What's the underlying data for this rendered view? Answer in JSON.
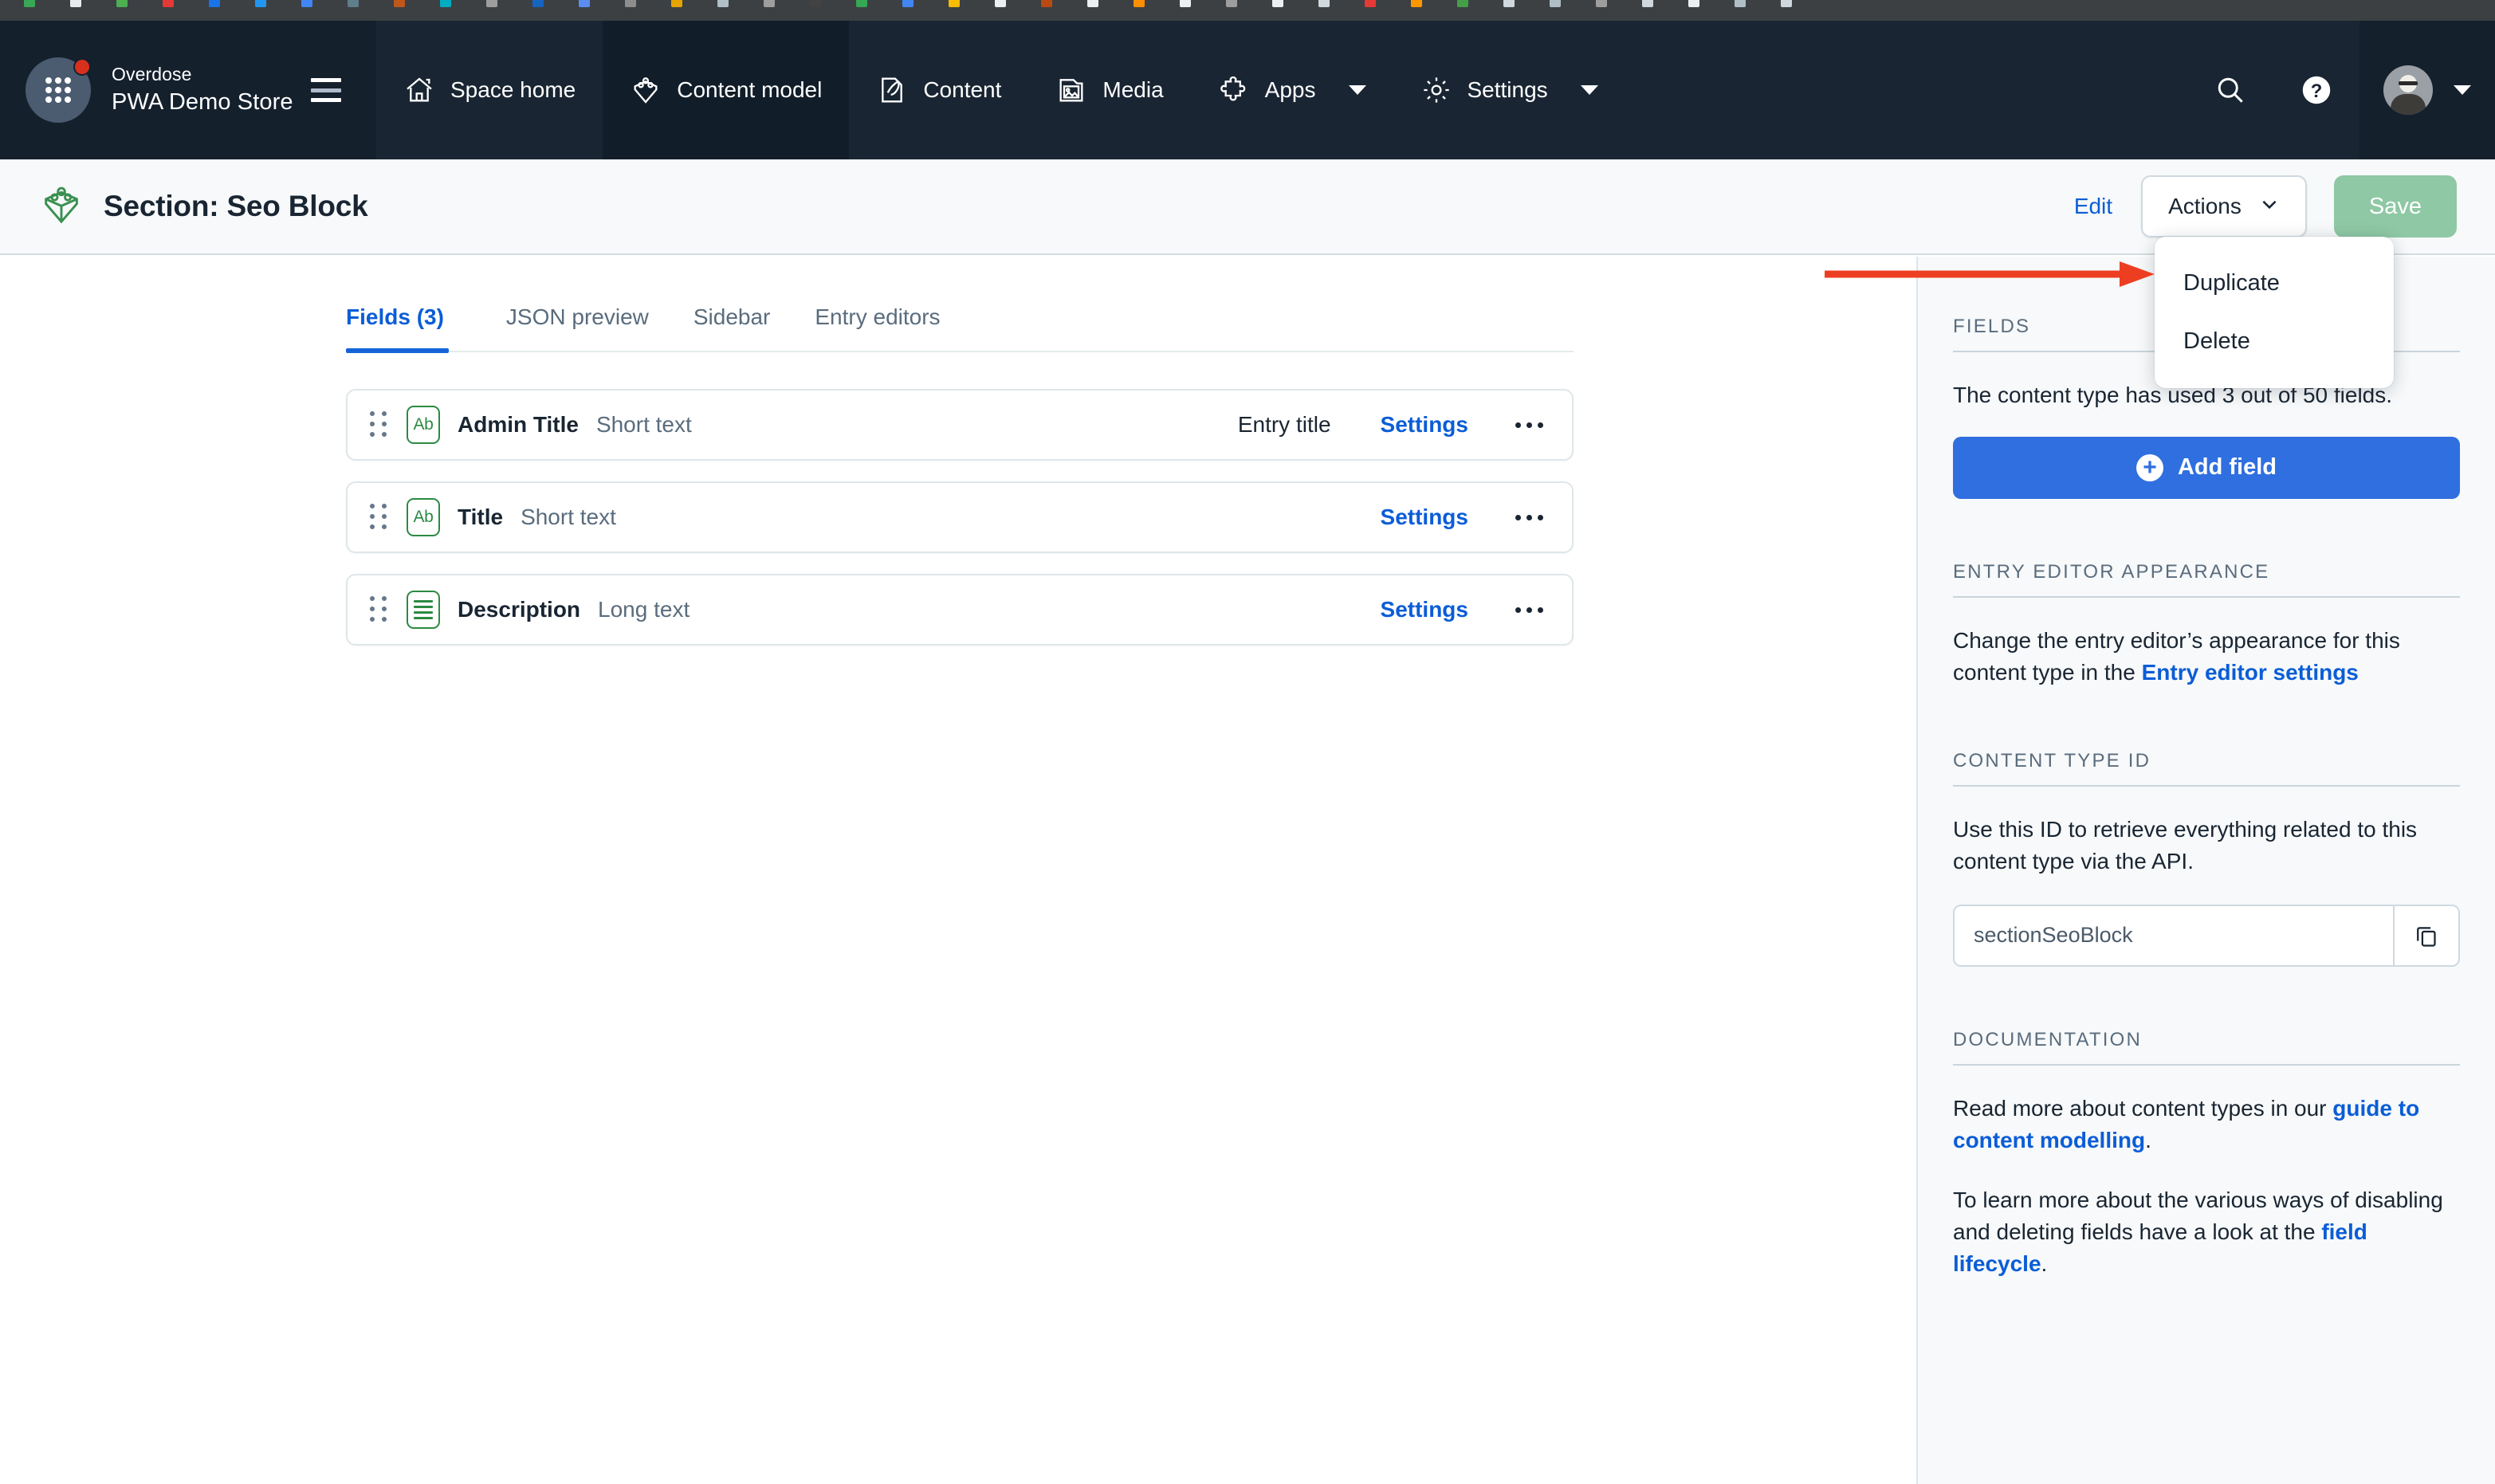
{
  "browser": {
    "favicon_colors": [
      "#3aa757",
      "#e8eaed",
      "#4caf50",
      "#e53935",
      "#1a73e8",
      "#2196f3",
      "#4285f4",
      "#607d8b",
      "#c0571a",
      "#00acc1",
      "#9e9e9e",
      "#1565c0",
      "#5b8def",
      "#8d8d8d",
      "#e6a400",
      "#b0bec5",
      "#9e9e9e",
      "#424242",
      "#34a853",
      "#4285f4",
      "#fbbc05",
      "#eceff1",
      "#b84a12",
      "#eceff1",
      "#ff8f00",
      "#eceff1",
      "#9e9e9e",
      "#eceff1",
      "#cfd8dc",
      "#e53935",
      "#ff9800",
      "#43a047",
      "#cfd8dc",
      "#b0bec5",
      "#9e9e9e",
      "#cfd8dc",
      "#eceff1",
      "#b0bec5",
      "#cfd8dc"
    ]
  },
  "topnav": {
    "org_name": "Overdose",
    "space_name": "PWA Demo Store",
    "menu_icon": "hamburger-icon",
    "items": [
      {
        "label": "Space home",
        "icon": "home-icon",
        "active": false,
        "has_caret": false
      },
      {
        "label": "Content model",
        "icon": "content-model-icon",
        "active": true,
        "has_caret": false
      },
      {
        "label": "Content",
        "icon": "content-pen-icon",
        "active": false,
        "has_caret": false
      },
      {
        "label": "Media",
        "icon": "media-image-icon",
        "active": false,
        "has_caret": false
      },
      {
        "label": "Apps",
        "icon": "puzzle-icon",
        "active": false,
        "has_caret": true
      },
      {
        "label": "Settings",
        "icon": "gear-icon",
        "active": false,
        "has_caret": true
      }
    ],
    "search_icon": "search-icon",
    "help_icon": "help-circle-icon",
    "avatar_icon": "user-avatar",
    "user_caret": "chevron-down-icon"
  },
  "header": {
    "icon": "content-type-block-icon",
    "title": "Section: Seo Block",
    "edit_label": "Edit",
    "actions_label": "Actions",
    "actions_caret": "chevron-down-icon",
    "save_label": "Save"
  },
  "actions_menu": {
    "items": [
      {
        "label": "Duplicate"
      },
      {
        "label": "Delete"
      }
    ]
  },
  "main": {
    "tabs": [
      {
        "label": "Fields (3)",
        "active": true
      },
      {
        "label": "JSON preview",
        "active": false
      },
      {
        "label": "Sidebar",
        "active": false
      },
      {
        "label": "Entry editors",
        "active": false
      }
    ],
    "fields": [
      {
        "name": "Admin Title",
        "type": "Short text",
        "type_icon": "short-text-icon",
        "badge": "Entry title",
        "settings_label": "Settings",
        "more_icon": "ellipsis-icon"
      },
      {
        "name": "Title",
        "type": "Short text",
        "type_icon": "short-text-icon",
        "badge": "",
        "settings_label": "Settings",
        "more_icon": "ellipsis-icon"
      },
      {
        "name": "Description",
        "type": "Long text",
        "type_icon": "long-text-icon",
        "badge": "",
        "settings_label": "Settings",
        "more_icon": "ellipsis-icon"
      }
    ]
  },
  "sidebar": {
    "fields_heading": "FIELDS",
    "fields_usage": "The content type has used 3 out of 50 fields.",
    "add_field_label": "Add field",
    "add_field_icon": "plus-circle-icon",
    "entry_editor_heading": "ENTRY EDITOR APPEARANCE",
    "entry_editor_text_a": "Change the entry editor’s appearance for this content type in the ",
    "entry_editor_link": "Entry editor settings",
    "content_type_id_heading": "CONTENT TYPE ID",
    "content_type_id_text": "Use this ID to retrieve everything related to this content type via the API.",
    "content_type_id_value": "sectionSeoBlock",
    "copy_icon": "copy-icon",
    "documentation_heading": "DOCUMENTATION",
    "doc_text_a": "Read more about content types in our ",
    "doc_link_a": "guide to content modelling",
    "doc_text_a_end": ".",
    "doc_text_b": "To learn more about the various ways of disabling and deleting fields have a look at the ",
    "doc_link_b": "field lifecycle",
    "doc_text_b_end": "."
  },
  "annotation": {
    "arrow_icon": "red-arrow-annotation",
    "arrow_color": "#ee3e22"
  },
  "colors": {
    "nav_bg": "#192532",
    "nav_bg_dark": "#15202d",
    "accent_blue": "#0b5dd7",
    "primary_blue": "#2f6fe0",
    "green_icon": "#2c8a43",
    "save_green": "#8ec8a4",
    "page_bg": "#ffffff",
    "sidebar_bg": "#f7f9fa",
    "annotation_red": "#ee3e22"
  }
}
